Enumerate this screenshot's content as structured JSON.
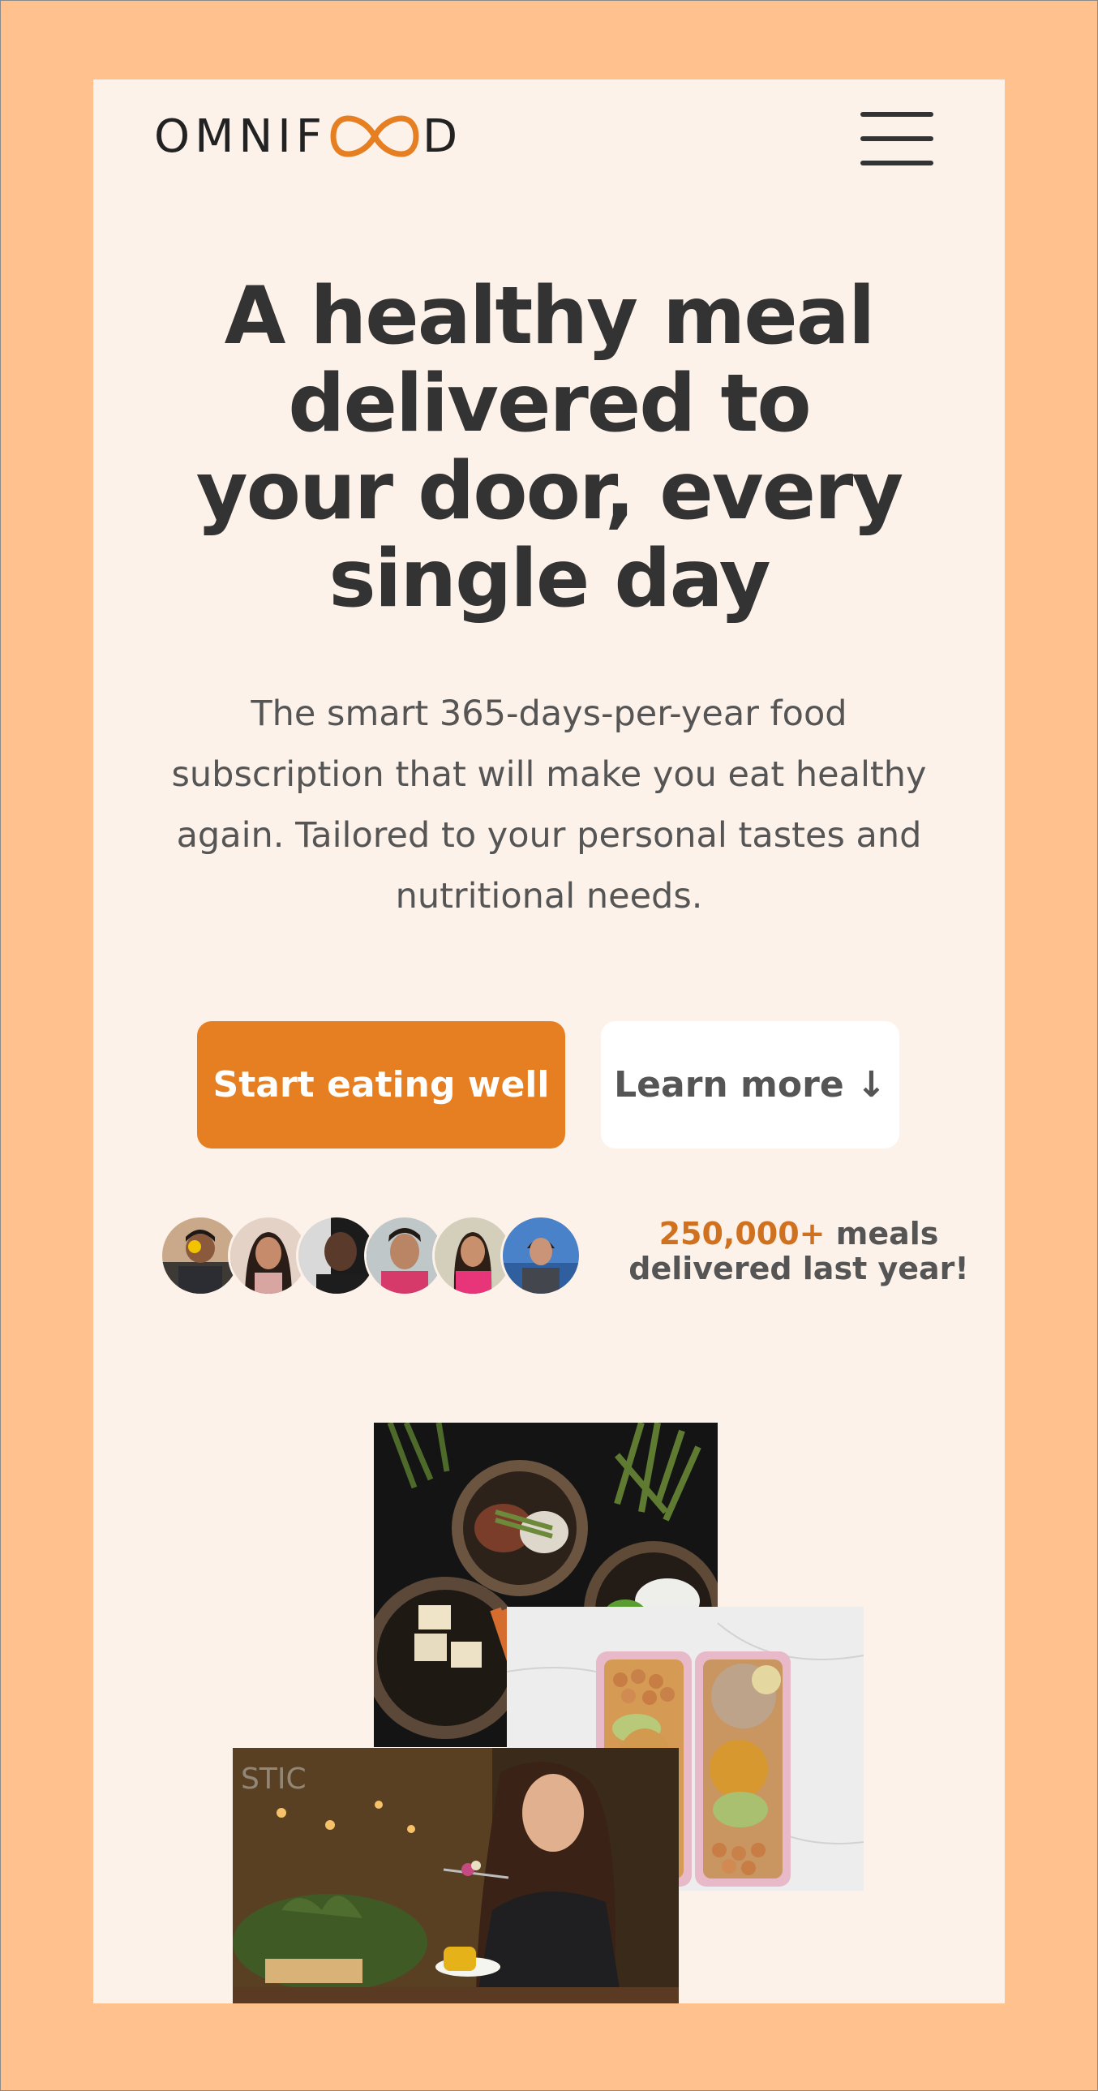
{
  "header": {
    "logo_text_left": "OMNIF",
    "logo_text_right": "D",
    "logo_icon": "infinity-icon",
    "menu_icon": "hamburger-menu-icon"
  },
  "hero": {
    "title": "A healthy meal delivered to your door, every single day",
    "description": "The smart 365-days-per-year food subscription that will make you eat healthy again. Tailored to your personal tastes and nutritional needs.",
    "primary_button": "Start eating well",
    "secondary_button": "Learn more ↓"
  },
  "delivered": {
    "count": "250,000+",
    "text": "meals delivered last year!",
    "avatars": [
      "customer-1",
      "customer-2",
      "customer-3",
      "customer-4",
      "customer-5",
      "customer-6"
    ]
  },
  "images": [
    "meal-bowls-photo",
    "meal-prep-boxes-photo",
    "woman-eating-photo"
  ],
  "colors": {
    "background_outer": "#ffc28f",
    "page_background": "#fdf2e9",
    "accent": "#e67e22",
    "highlight_text": "#cf711f",
    "heading": "#333333",
    "body_text": "#555555"
  }
}
